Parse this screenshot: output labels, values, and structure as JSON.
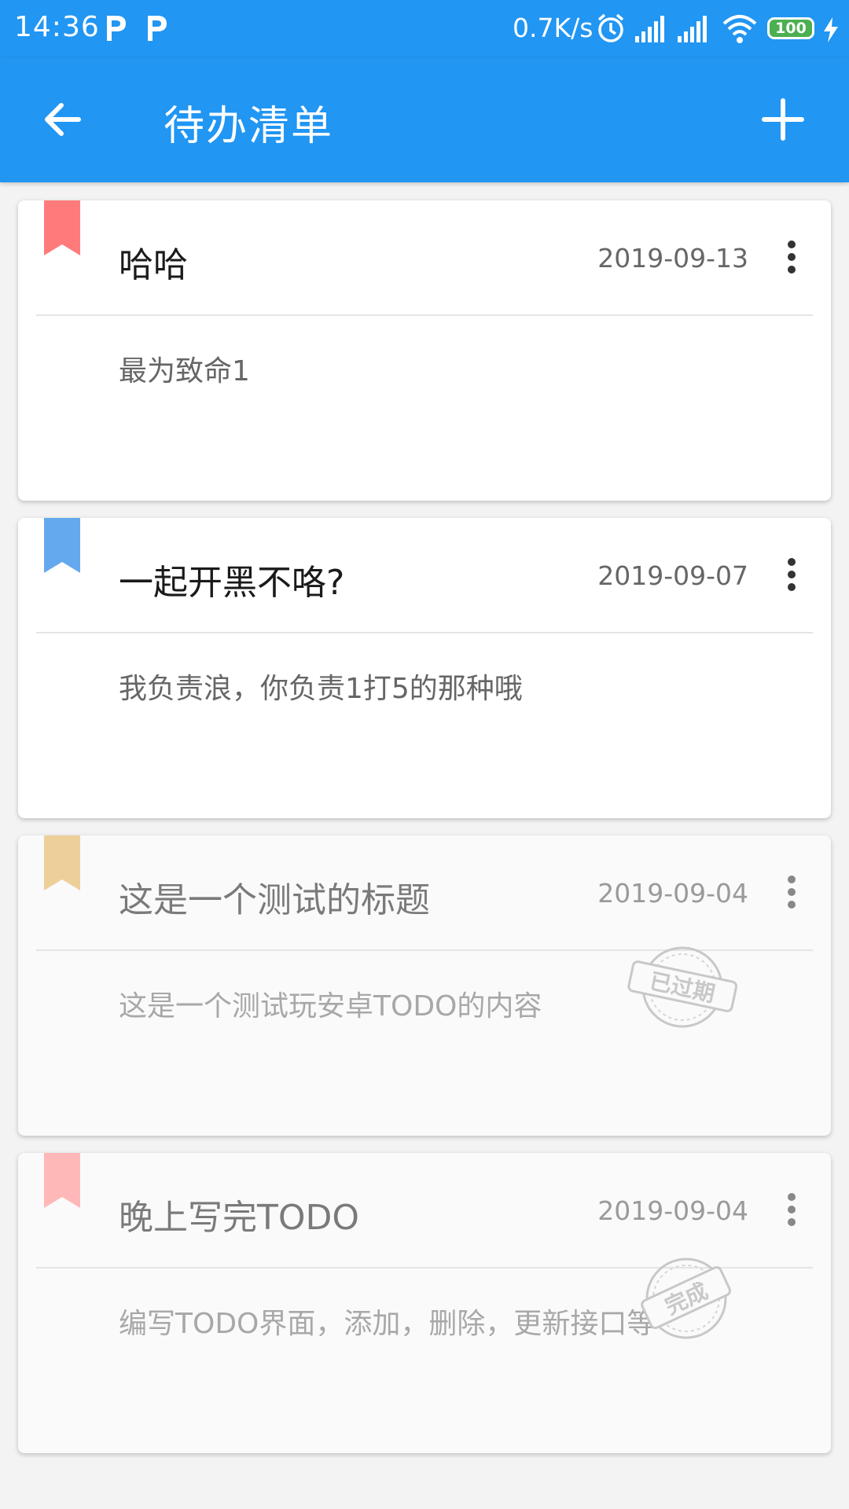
{
  "status_bar": {
    "time": "14:36",
    "net_speed": "0.7K/s",
    "battery": "100",
    "accent": "#2196F3"
  },
  "app_bar": {
    "title": "待办清单",
    "back_icon": "arrow-left-icon",
    "add_icon": "plus-icon"
  },
  "todos": [
    {
      "title": "哈哈",
      "date": "2019-09-13",
      "content": "最为致命1",
      "bookmark_color": "#FF7B7B",
      "state": "active"
    },
    {
      "title": "一起开黑不咯?",
      "date": "2019-09-07",
      "content": "我负责浪，你负责1打5的那种哦",
      "bookmark_color": "#64A9EE",
      "state": "active"
    },
    {
      "title": "这是一个测试的标题",
      "date": "2019-09-04",
      "content": "这是一个测试玩安卓TODO的内容",
      "bookmark_color": "#EDCF9A",
      "state": "expired",
      "stamp": "已过期"
    },
    {
      "title": "晚上写完TODO",
      "date": "2019-09-04",
      "content": "编写TODO界面，添加，删除，更新接口等",
      "bookmark_color": "#FFB8B8",
      "state": "completed",
      "stamp": "完成"
    }
  ]
}
